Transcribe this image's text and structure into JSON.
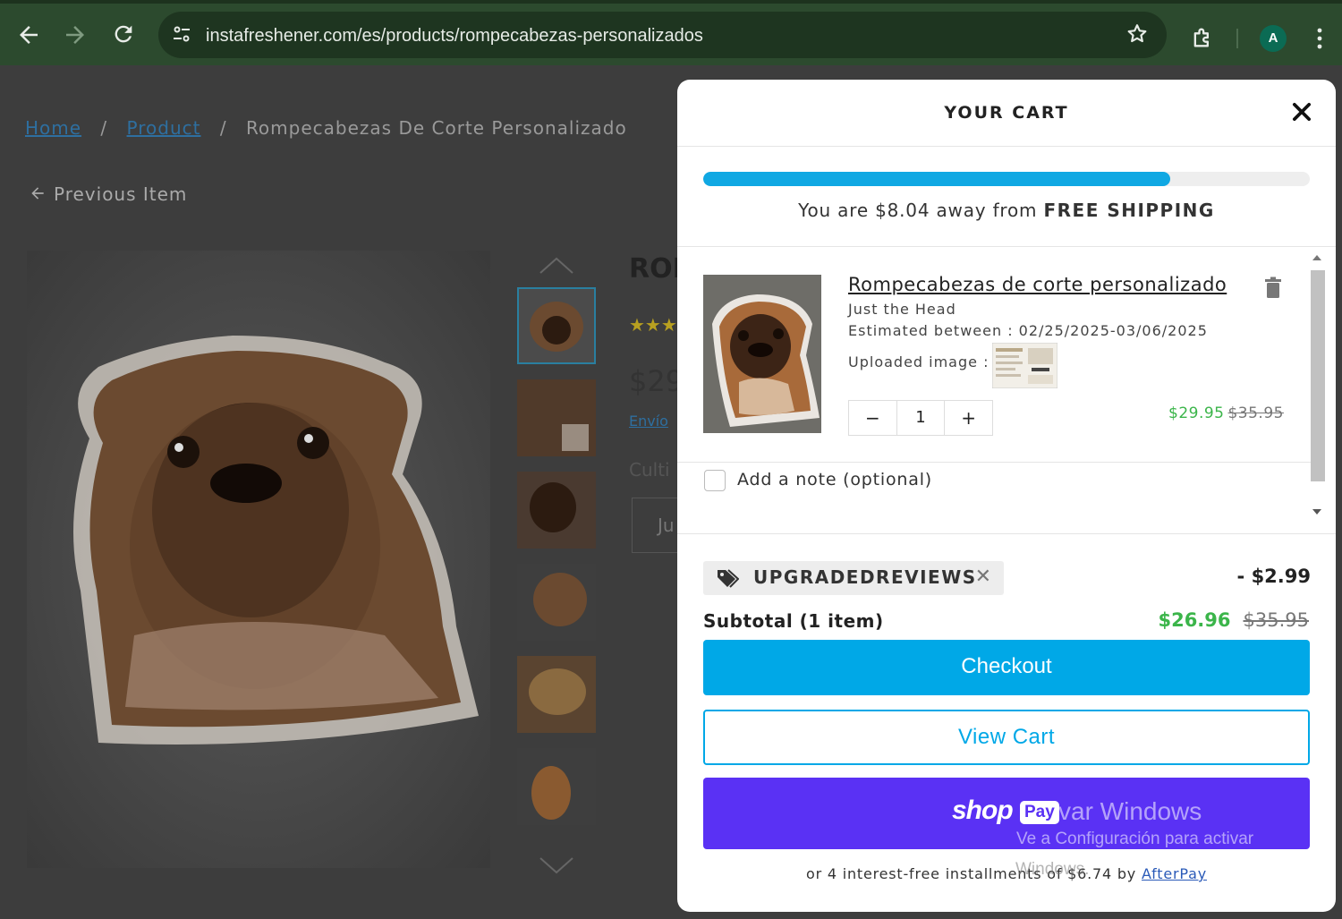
{
  "browser": {
    "url": "instafreshener.com/es/products/rompecabezas-personalizados",
    "profile_initial": "A"
  },
  "page": {
    "breadcrumb": {
      "home": "Home",
      "product": "Product",
      "current": "Rompecabezas De Corte Personalizado",
      "sep": "/"
    },
    "previous_item": "Previous Item",
    "title_fragment": "ROI",
    "stars_fragment": "★★★",
    "price_fragment": "$29",
    "envio_fragment": "Envío",
    "cult_fragment": "Culti",
    "select_fragment": "Ju"
  },
  "cart": {
    "title": "YOUR CART",
    "shipping_progress": 0.77,
    "shipping_msg_prefix": "You are $8.04 away from ",
    "shipping_msg_bold": "FREE SHIPPING",
    "item": {
      "name": "Rompecabezas de corte personalizado",
      "variant": "Just the Head",
      "estimated": "Estimated between : 02/25/2025-03/06/2025",
      "uploaded_label": "Uploaded image :",
      "quantity": "1",
      "minus": "−",
      "plus": "+",
      "price": "$29.95",
      "compare_price": "$35.95"
    },
    "note_label": "Add a note (optional)",
    "discount_code": "UPGRADEDREVIEWS",
    "discount_remove": "✕",
    "discount_amount": "- $2.99",
    "subtotal_label": "Subtotal (1 item)",
    "subtotal": "$26.96",
    "subtotal_compare": "$35.95",
    "checkout_label": "Checkout",
    "view_cart_label": "View Cart",
    "shop_word": "shop",
    "pay_word": "Pay",
    "afterpay_text": "or 4 interest-free installments of $6.74 by ",
    "afterpay_link": "AfterPay"
  },
  "os_watermark": {
    "line1": "var Windows",
    "line2": "Ve a Configuración para activar",
    "line3": "Windows."
  },
  "colors": {
    "accent": "#00a8e7",
    "shoppay": "#5a31f4",
    "sale": "#3bb54a"
  }
}
